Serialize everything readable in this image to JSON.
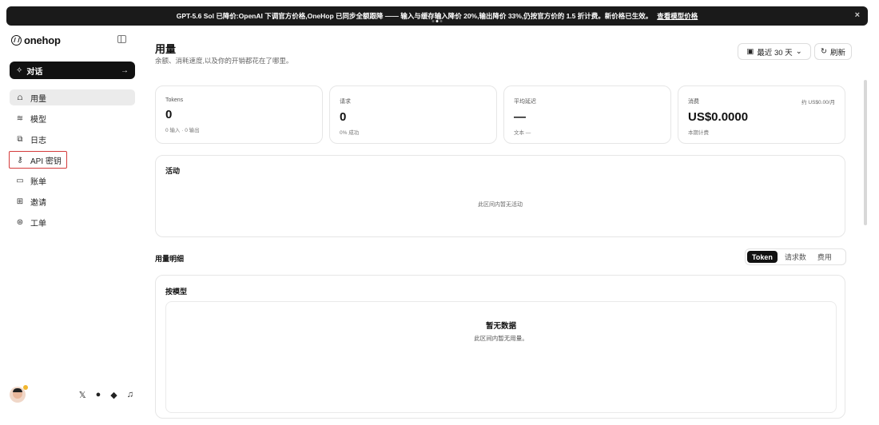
{
  "banner": {
    "text": "GPT-5.6 Sol 已降价:OpenAI 下调官方价格,OneHop 已同步全额跟降 —— 输入与缓存输入降价 20%,输出降价 33%,仍按官方价的 1.5 折计费。新价格已生效。",
    "link": "查看模型价格",
    "close": "×"
  },
  "sidebar": {
    "logo_text": "onehop",
    "chat_label": "对话",
    "chat_arrow": "→",
    "items": [
      {
        "icon": "bar-chart-icon",
        "glyph": "⩍",
        "label": "用量"
      },
      {
        "icon": "layers-icon",
        "glyph": "≋",
        "label": "模型"
      },
      {
        "icon": "log-icon",
        "glyph": "⧉",
        "label": "日志"
      },
      {
        "icon": "key-icon",
        "glyph": "⚷",
        "label": "API 密钥"
      },
      {
        "icon": "card-icon",
        "glyph": "▭",
        "label": "账单"
      },
      {
        "icon": "gift-icon",
        "glyph": "⊞",
        "label": "邀请"
      },
      {
        "icon": "support-icon",
        "glyph": "⊛",
        "label": "工单"
      }
    ],
    "social": [
      {
        "icon": "x-icon",
        "glyph": "𝕏"
      },
      {
        "icon": "github-icon",
        "glyph": "●"
      },
      {
        "icon": "discord-icon",
        "glyph": "◆"
      },
      {
        "icon": "bell-icon",
        "glyph": "♫"
      }
    ]
  },
  "header": {
    "title": "用量",
    "subtitle": "余额、消耗速度,以及你的开销都花在了哪里。",
    "range_label": "最近 30 天",
    "refresh_label": "刷新"
  },
  "cards": [
    {
      "label": "Tokens",
      "value": "0",
      "note": "0 输入 · 0 输出",
      "corner": ""
    },
    {
      "label": "请求",
      "value": "0",
      "note": "0% 成功",
      "corner": ""
    },
    {
      "label": "平均延迟",
      "value": "—",
      "note": "文本 —",
      "corner": ""
    },
    {
      "label": "消费",
      "value": "US$0.0000",
      "note": "本期计费",
      "corner": "约 US$0.00/月"
    }
  ],
  "activity": {
    "title": "活动",
    "empty": "此区间内暂无活动"
  },
  "detail": {
    "title": "用量明细",
    "tabs": [
      "Token",
      "请求数",
      "费用"
    ],
    "active_tab": "Token"
  },
  "bymodel": {
    "title": "按模型",
    "empty_title": "暂无数据",
    "empty_desc": "此区间内暂无用量。"
  },
  "colors": {
    "accent": "#111111",
    "highlight_outline": "#d43b3b"
  }
}
